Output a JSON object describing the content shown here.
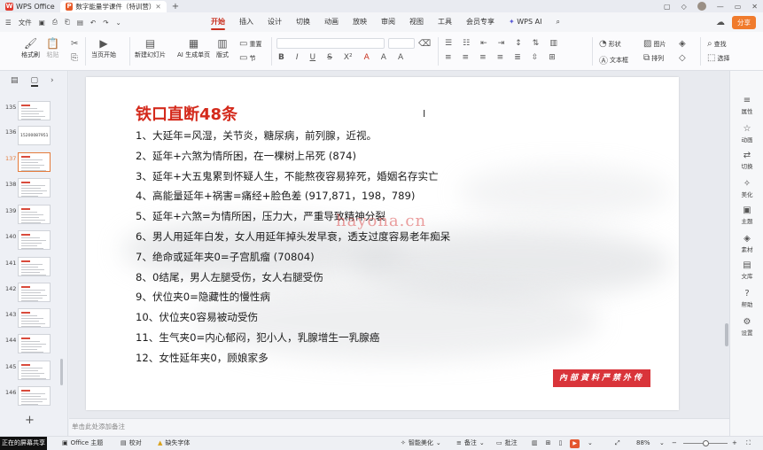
{
  "titlebar": {
    "app_name": "WPS Office",
    "doc_tab": "数字能量学课件（特训营）",
    "plus": "+"
  },
  "menubar": {
    "file": "文件",
    "tabs": [
      "开始",
      "插入",
      "设计",
      "切换",
      "动画",
      "放映",
      "审阅",
      "视图",
      "工具",
      "会员专享"
    ],
    "active_tab": "开始",
    "wps_ai": "WPS AI",
    "share": "分享"
  },
  "toolbar": {
    "format_painter": "格式刷",
    "paste": "粘贴",
    "start_from_current": "当页开始",
    "new_slide": "新建幻灯片",
    "ai_slide": "AI 生成单页",
    "layout": "版式",
    "reset": "重置",
    "section": "节",
    "shape": "形状",
    "picture": "图片",
    "textbox": "文本框",
    "arrange": "排列",
    "find": "查找",
    "select": "选择"
  },
  "slides_panel": {
    "numbers": [
      "135",
      "136",
      "137",
      "138",
      "139",
      "140",
      "141",
      "142",
      "143",
      "144",
      "145",
      "146"
    ],
    "selected": "137",
    "thumb_136_text": "15200087951"
  },
  "slide": {
    "title": "铁口直断48条",
    "items": [
      "1、大延年=风湿，关节炎，糖尿病，前列腺，近视。",
      "2、延年+六煞为情所困，在一棵树上吊死 (874)",
      "3、延年+大五鬼累到怀疑人生，不能熬夜容易猝死，婚姻名存实亡",
      "4、高能量延年+祸害=痛经+脸色差 (917,871，198，789)",
      "5、延年+六煞=为情所困，压力大，严重导致精神分裂",
      "6、男人用延年白发，女人用延年掉头发早衰，透支过度容易老年痴呆",
      "7、绝命或延年夹0=子宫肌瘤 (70804)",
      "8、0结尾，男人左腿受伤，女人右腿受伤",
      "9、伏位夹0=隐藏性的慢性病",
      "10、伏位夹0容易被动受伤",
      "11、生气夹0=内心郁闷，犯小人，乳腺增生一乳腺癌",
      "12、女性延年夹0，顾娘家多"
    ],
    "watermark": "hayona.cn",
    "stamp": "內部資料严禁外传"
  },
  "notes_placeholder": "单击此处添加备注",
  "right_panel": [
    "属性",
    "动画",
    "切换",
    "美化",
    "主题",
    "素材",
    "文库",
    "帮助",
    "设置"
  ],
  "statusbar": {
    "share_text": "正在的屏幕共享",
    "theme": "Office 主题",
    "proofread": "校对",
    "missing_font": "缺失字体",
    "smart_beautify": "智能美化",
    "notes": "备注",
    "comments": "批注",
    "zoom": "88%"
  },
  "colors": {
    "accent": "#c8301e",
    "title_red": "#d42a1c",
    "stamp_red": "#d9343a",
    "share_orange": "#f07b2d"
  }
}
